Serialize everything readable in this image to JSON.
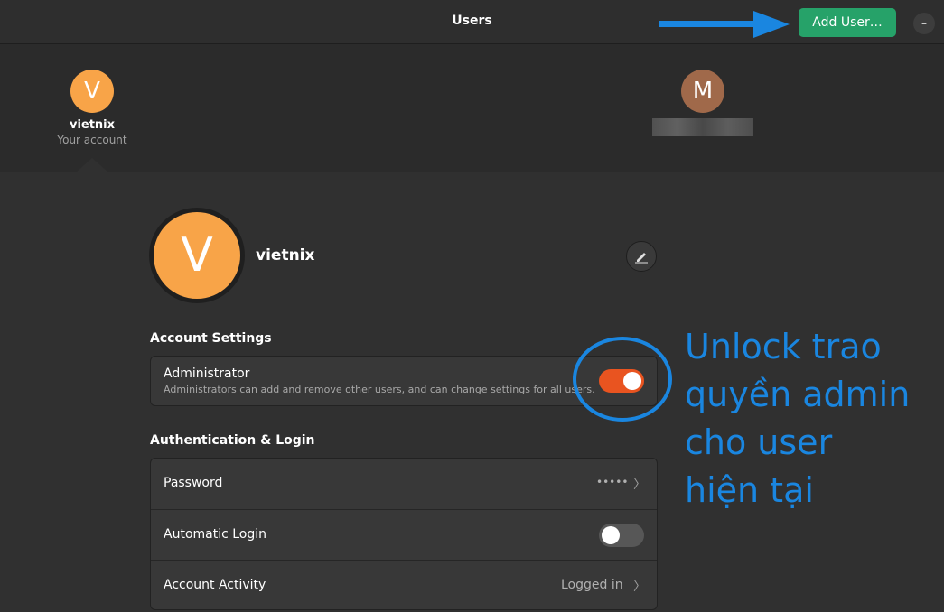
{
  "header": {
    "title": "Users",
    "add_user_label": "Add User…",
    "menu_icon": "–"
  },
  "carousel": {
    "users": [
      {
        "initial": "V",
        "name": "vietnix",
        "subtitle": "Your account",
        "avatar_color": "#f8a448"
      },
      {
        "initial": "M",
        "name_hidden": true,
        "avatar_color": "#a0694a"
      }
    ]
  },
  "profile": {
    "initial": "V",
    "name": "vietnix",
    "avatar_color": "#f8a448"
  },
  "account_settings": {
    "title": "Account Settings",
    "administrator": {
      "label": "Administrator",
      "description": "Administrators can add and remove other users, and can change settings for all users.",
      "enabled": true
    }
  },
  "auth": {
    "title": "Authentication & Login",
    "password": {
      "label": "Password",
      "value": "•••••"
    },
    "automatic_login": {
      "label": "Automatic Login",
      "enabled": false
    },
    "account_activity": {
      "label": "Account Activity",
      "value": "Logged in"
    }
  },
  "annotation": {
    "lines": [
      "Unlock trao",
      "quyền admin",
      "cho user",
      "hiện tại"
    ],
    "color": "#1a86e0"
  },
  "colors": {
    "accent_green": "#26a269",
    "toggle_on": "#e95420",
    "toggle_off": "#575757"
  }
}
